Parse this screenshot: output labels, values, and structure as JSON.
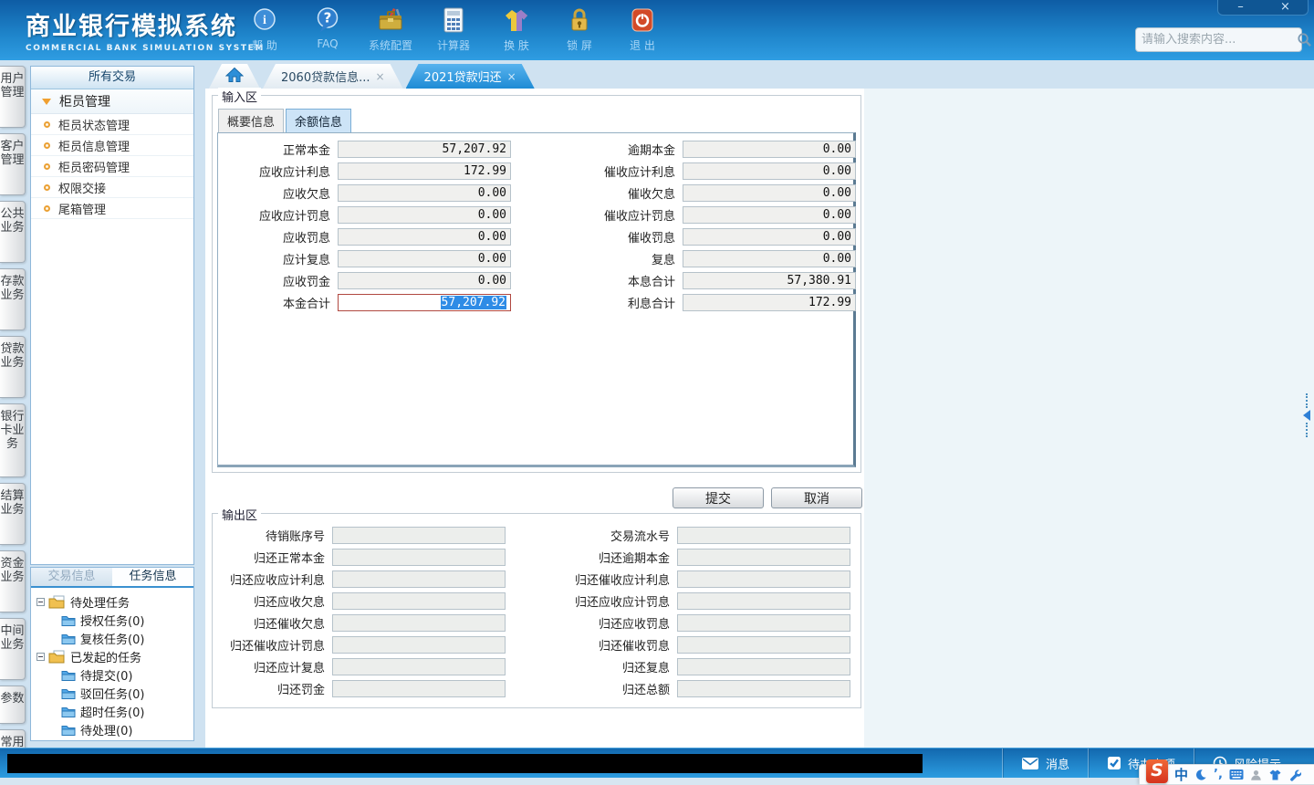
{
  "window": {
    "title": "商业银行模拟系统",
    "subtitle": "COMMERCIAL BANK SIMULATION SYSTEM",
    "minimize": "–",
    "close": "×"
  },
  "toolbar": {
    "items": [
      {
        "id": "help",
        "icon": "info-icon",
        "label": "帮 助"
      },
      {
        "id": "faq",
        "icon": "faq-icon",
        "label": "FAQ"
      },
      {
        "id": "config",
        "icon": "system-config-icon",
        "label": "系统配置"
      },
      {
        "id": "calc",
        "icon": "calculator-icon",
        "label": "计算器"
      },
      {
        "id": "skin",
        "icon": "skin-shirt-icon",
        "label": "换 肤"
      },
      {
        "id": "lock",
        "icon": "lock-screen-icon",
        "label": "锁 屏"
      },
      {
        "id": "exit",
        "icon": "exit-power-icon",
        "label": "退 出"
      }
    ]
  },
  "search": {
    "placeholder": "请输入搜索内容..."
  },
  "side_rail": {
    "tabs": [
      "用户管理",
      "客户管理",
      "公共业务",
      "存款业务",
      "贷款业务",
      "银行卡业务",
      "结算业务",
      "资金业务",
      "中间业务",
      "参数",
      "常用工具"
    ]
  },
  "sidebar": {
    "header": "所有交易",
    "group": "柜员管理",
    "items": [
      "柜员状态管理",
      "柜员信息管理",
      "柜员密码管理",
      "权限交接",
      "尾箱管理"
    ]
  },
  "task_panel": {
    "tabs": [
      "交易信息",
      "任务信息"
    ],
    "active": "任务信息",
    "tree": [
      {
        "label": "待处理任务",
        "children": [
          "授权任务(0)",
          "复核任务(0)"
        ]
      },
      {
        "label": "已发起的任务",
        "children": [
          "待提交(0)",
          "驳回任务(0)",
          "超时任务(0)",
          "待处理(0)"
        ]
      }
    ]
  },
  "tabs": {
    "items": [
      "2060贷款信息...",
      "2021贷款归还"
    ],
    "active": "2021贷款归还",
    "close_glyph": "×"
  },
  "input_area": {
    "legend": "输入区",
    "tabs": [
      "概要信息",
      "余额信息"
    ],
    "active_tab": "余额信息",
    "left_fields": [
      {
        "label": "正常本金",
        "value": "57,207.92"
      },
      {
        "label": "应收应计利息",
        "value": "172.99"
      },
      {
        "label": "应收欠息",
        "value": "0.00"
      },
      {
        "label": "应收应计罚息",
        "value": "0.00"
      },
      {
        "label": "应收罚息",
        "value": "0.00"
      },
      {
        "label": "应计复息",
        "value": "0.00"
      },
      {
        "label": "应收罚金",
        "value": "0.00"
      },
      {
        "label": "本金合计",
        "value": "57,207.92",
        "focused": true
      }
    ],
    "right_fields": [
      {
        "label": "逾期本金",
        "value": "0.00"
      },
      {
        "label": "催收应计利息",
        "value": "0.00"
      },
      {
        "label": "催收欠息",
        "value": "0.00"
      },
      {
        "label": "催收应计罚息",
        "value": "0.00"
      },
      {
        "label": "催收罚息",
        "value": "0.00"
      },
      {
        "label": "复息",
        "value": "0.00"
      },
      {
        "label": "本息合计",
        "value": "57,380.91"
      },
      {
        "label": "利息合计",
        "value": "172.99"
      }
    ]
  },
  "buttons": {
    "submit": "提交",
    "cancel": "取消"
  },
  "output_area": {
    "legend": "输出区",
    "left_fields": [
      {
        "label": "待销账序号",
        "value": ""
      },
      {
        "label": "归还正常本金",
        "value": ""
      },
      {
        "label": "归还应收应计利息",
        "value": ""
      },
      {
        "label": "归还应收欠息",
        "value": ""
      },
      {
        "label": "归还催收欠息",
        "value": ""
      },
      {
        "label": "归还催收应计罚息",
        "value": ""
      },
      {
        "label": "归还应计复息",
        "value": ""
      },
      {
        "label": "归还罚金",
        "value": ""
      }
    ],
    "right_fields": [
      {
        "label": "交易流水号",
        "value": ""
      },
      {
        "label": "归还逾期本金",
        "value": ""
      },
      {
        "label": "归还催收应计利息",
        "value": ""
      },
      {
        "label": "归还应收应计罚息",
        "value": ""
      },
      {
        "label": "归还应收罚息",
        "value": ""
      },
      {
        "label": "归还催收罚息",
        "value": ""
      },
      {
        "label": "归还复息",
        "value": ""
      },
      {
        "label": "归还总额",
        "value": ""
      }
    ]
  },
  "statusbar": {
    "items": [
      {
        "id": "msg",
        "icon": "message-icon",
        "label": "消息"
      },
      {
        "id": "todo",
        "icon": "todo-icon",
        "label": "待办事项"
      },
      {
        "id": "risk",
        "icon": "risk-icon",
        "label": "风险提示"
      }
    ]
  },
  "ime": {
    "lang": "中",
    "punctuation": "’,"
  },
  "colors": {
    "accent": "#1f86cc",
    "active_tab": "#1e8bd5",
    "selection": "#2e8ce6",
    "focus_border": "#b04840"
  }
}
